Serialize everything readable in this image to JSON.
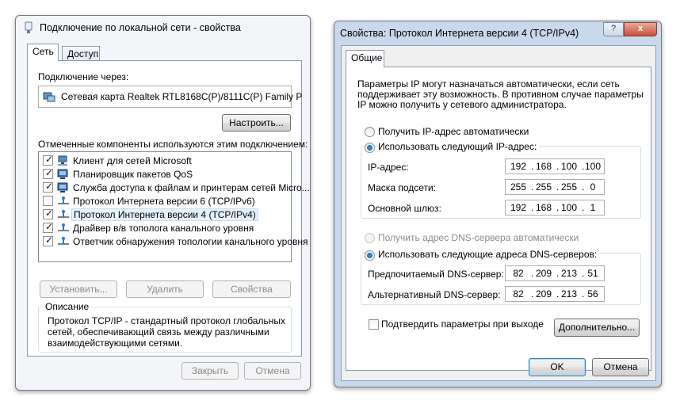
{
  "win1": {
    "title": "Подключение по локальной сети - свойства",
    "tabs": [
      "Сеть",
      "Доступ"
    ],
    "connect_via_label": "Подключение через:",
    "adapter": "Сетевая карта Realtek RTL8168C(P)/8111C(P) Family P",
    "configure_button": "Настроить...",
    "components_label": "Отмеченные компоненты используются этим подключением:",
    "components": [
      {
        "label": "Клиент для сетей Microsoft",
        "checked": true,
        "icon": "network-client-icon"
      },
      {
        "label": "Планировщик пакетов QoS",
        "checked": true,
        "icon": "network-service-icon"
      },
      {
        "label": "Служба доступа к файлам и принтерам сетей Micro...",
        "checked": true,
        "icon": "network-service-icon"
      },
      {
        "label": "Протокол Интернета версии 6 (TCP/IPv6)",
        "checked": false,
        "icon": "protocol-icon"
      },
      {
        "label": "Протокол Интернета версии 4 (TCP/IPv4)",
        "checked": true,
        "icon": "protocol-icon",
        "selected": true
      },
      {
        "label": "Драйвер в/в тополога канального уровня",
        "checked": true,
        "icon": "protocol-icon"
      },
      {
        "label": "Ответчик обнаружения топологии канального уровня",
        "checked": true,
        "icon": "protocol-icon"
      }
    ],
    "install_button": "Установить...",
    "remove_button": "Удалить",
    "properties_button": "Свойства",
    "description_title": "Описание",
    "description_lines": [
      "Протокол TCP/IP - стандартный протокол глобальных",
      "сетей, обеспечивающий связь между различными",
      "взаимодействующими сетями."
    ],
    "close_button": "Закрыть",
    "cancel_button": "Отмена"
  },
  "win2": {
    "title": "Свойства: Протокол Интернета версии 4 (TCP/IPv4)",
    "help_glyph": "?",
    "close_glyph": "x",
    "tab": "Общие",
    "intro_lines": [
      "Параметры IP могут назначаться автоматически, если сеть",
      "поддерживает эту возможность. В противном случае параметры",
      "IP можно получить у сетевого администратора."
    ],
    "radio_ip_auto": "Получить IP-адрес автоматически",
    "radio_ip_manual": "Использовать следующий IP-адрес:",
    "ip_label": "IP-адрес:",
    "ip": [
      "192",
      "168",
      "100",
      "100"
    ],
    "mask_label": "Маска подсети:",
    "mask": [
      "255",
      "255",
      "255",
      "0"
    ],
    "gateway_label": "Основной шлюз:",
    "gateway": [
      "192",
      "168",
      "100",
      "1"
    ],
    "radio_dns_auto": "Получить адрес DNS-сервера автоматически",
    "radio_dns_manual": "Использовать следующие адреса DNS-серверов:",
    "dns_pref_label": "Предпочитаемый DNS-сервер:",
    "dns_pref": [
      "82",
      "209",
      "213",
      "51"
    ],
    "dns_alt_label": "Альтернативный DNS-сервер:",
    "dns_alt": [
      "82",
      "209",
      "213",
      "56"
    ],
    "validate_label": "Подтвердить параметры при выходе",
    "advanced_button": "Дополнительно...",
    "ok_button": "OK",
    "cancel_button": "Отмена"
  },
  "colors": {
    "accent": "#3399ff",
    "selection": "#cce8ff",
    "frame_win2": "#c9d8ea"
  }
}
